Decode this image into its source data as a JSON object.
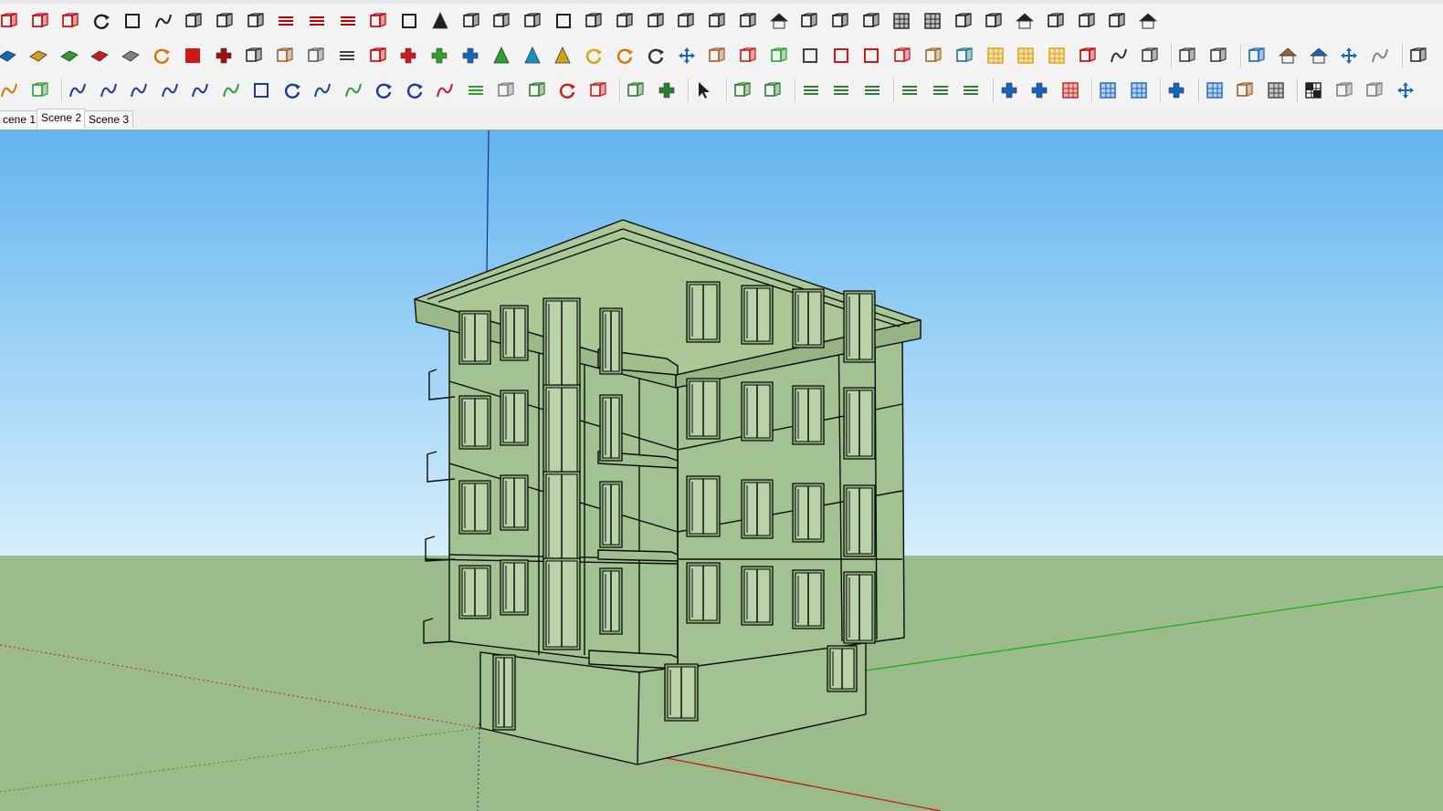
{
  "toolbars": {
    "row1": [
      {
        "name": "dimensions-icon",
        "color": "#c00000"
      },
      {
        "name": "paint-bucket-icon",
        "color": "#c00000"
      },
      {
        "name": "tape-measure-icon",
        "color": "#c00000"
      },
      {
        "name": "sphere-icon",
        "color": "#202020"
      },
      {
        "name": "box-outline-icon",
        "color": "#202020"
      },
      {
        "name": "curve-icon",
        "color": "#202020"
      },
      {
        "name": "cube-icon",
        "color": "#202020"
      },
      {
        "name": "shell-icon",
        "color": "#202020"
      },
      {
        "name": "extrude-icon",
        "color": "#202020"
      },
      {
        "name": "corner-line-icon",
        "color": "#c00000"
      },
      {
        "name": "corner-line-alt-icon",
        "color": "#c00000"
      },
      {
        "name": "arrow-line-icon",
        "color": "#c00000"
      },
      {
        "name": "sweep-icon",
        "color": "#c00000"
      },
      {
        "name": "frame-icon",
        "color": "#202020"
      },
      {
        "name": "cone-icon",
        "color": "#202020"
      },
      {
        "name": "columns-icon",
        "color": "#202020"
      },
      {
        "name": "cylinder-icon",
        "color": "#202020"
      },
      {
        "name": "bin-icon",
        "color": "#202020"
      },
      {
        "name": "panel-icon",
        "color": "#202020"
      },
      {
        "name": "prism-icon",
        "color": "#202020"
      },
      {
        "name": "stairs-icon",
        "color": "#202020"
      },
      {
        "name": "blade-icon",
        "color": "#202020"
      },
      {
        "name": "branch-icon",
        "color": "#202020"
      },
      {
        "name": "branch-alt-icon",
        "color": "#202020"
      },
      {
        "name": "split-icon",
        "color": "#202020"
      },
      {
        "name": "dome-icon",
        "color": "#202020"
      },
      {
        "name": "hatch-icon",
        "color": "#202020"
      },
      {
        "name": "slab-icon",
        "color": "#202020"
      },
      {
        "name": "wall-icon",
        "color": "#202020"
      },
      {
        "name": "grid-wall-icon",
        "color": "#202020"
      },
      {
        "name": "mesh-icon",
        "color": "#202020"
      },
      {
        "name": "louver-icon",
        "color": "#202020"
      },
      {
        "name": "fence-icon",
        "color": "#202020"
      },
      {
        "name": "shell-dome-icon",
        "color": "#202020"
      },
      {
        "name": "ribbed-icon",
        "color": "#202020"
      },
      {
        "name": "fan-icon",
        "color": "#202020"
      },
      {
        "name": "fan-alt-icon",
        "color": "#202020"
      },
      {
        "name": "house-icon",
        "color": "#202020"
      }
    ],
    "row2": [
      {
        "name": "blue-face-icon",
        "color": "#1565c0"
      },
      {
        "name": "yellow-face-icon",
        "color": "#d4a017"
      },
      {
        "name": "green-face-icon",
        "color": "#2e9e2e"
      },
      {
        "name": "red-face-icon",
        "color": "#d01818"
      },
      {
        "name": "outline-face-icon",
        "color": "#808080"
      },
      {
        "name": "rotate-icon",
        "color": "#e07000"
      },
      {
        "name": "red-square-icon",
        "color": "#d01818"
      },
      {
        "name": "lines-box-icon",
        "color": "#a01010"
      },
      {
        "name": "flag-icon",
        "color": "#303030"
      },
      {
        "name": "wood-block-icon",
        "color": "#a0602a"
      },
      {
        "name": "chain-icon",
        "color": "#606060"
      },
      {
        "name": "stairs-outline-icon",
        "color": "#404040"
      },
      {
        "name": "node-path-icon",
        "color": "#c00000"
      },
      {
        "name": "red-cross-icon",
        "color": "#d01818"
      },
      {
        "name": "green-cross-icon",
        "color": "#2e9e2e"
      },
      {
        "name": "blue-x-icon",
        "color": "#1565c0"
      },
      {
        "name": "cone-green-icon",
        "color": "#2e9e2e"
      },
      {
        "name": "cone-blue-icon",
        "color": "#1890c0"
      },
      {
        "name": "triangle-icon",
        "color": "#d4a017"
      },
      {
        "name": "hook-icon",
        "color": "#e0a000"
      },
      {
        "name": "twist-icon",
        "color": "#e07000"
      },
      {
        "name": "refresh-icon",
        "color": "#303030"
      },
      {
        "name": "move-icon",
        "color": "#1565c0"
      },
      {
        "name": "barrel-icon",
        "color": "#a0602a"
      },
      {
        "name": "undo-red-icon",
        "color": "#d01818"
      },
      {
        "name": "leaf-icon",
        "color": "#2e9e2e"
      },
      {
        "name": "box-arrow-icon",
        "color": "#404040"
      },
      {
        "name": "box-red-icon",
        "color": "#d01818"
      },
      {
        "name": "box-pair-icon",
        "color": "#d01818"
      },
      {
        "name": "diamond-icon",
        "color": "#d01818"
      },
      {
        "name": "cubes-icon",
        "color": "#a07020"
      },
      {
        "name": "layers-icon",
        "color": "#207090"
      },
      {
        "name": "grid-orange-icon",
        "color": "#e0a000"
      },
      {
        "name": "grid-yellow-icon",
        "color": "#e0a000"
      },
      {
        "name": "grid-light-icon",
        "color": "#e0a000"
      },
      {
        "name": "scatter-icon",
        "color": "#c00000"
      },
      {
        "name": "dotted-curve-icon",
        "color": "#303030"
      },
      {
        "name": "components-icon",
        "color": "#404040"
      },
      {
        "name": "pencil-icon",
        "color": "#404040"
      },
      {
        "name": "measure-ruler-icon",
        "color": "#404040"
      },
      {
        "name": "follow-me-icon",
        "color": "#1565c0"
      },
      {
        "name": "roof-icon",
        "color": "#a0602a"
      },
      {
        "name": "roof-blue-icon",
        "color": "#1565c0"
      },
      {
        "name": "arrow-blue-icon",
        "color": "#1565c0"
      },
      {
        "name": "curl-icon",
        "color": "#808080"
      },
      {
        "name": "scales-icon",
        "color": "#303030"
      }
    ],
    "row3": [
      {
        "name": "search-orange-icon",
        "color": "#e07000"
      },
      {
        "name": "polyhedron-icon",
        "color": "#2e9e2e"
      },
      {
        "name": "arc-icon",
        "color": "#1a3a9a"
      },
      {
        "name": "zigzag-icon",
        "color": "#1a3a9a"
      },
      {
        "name": "freehand-icon",
        "color": "#1a3a9a"
      },
      {
        "name": "wave-icon",
        "color": "#1a3a9a"
      },
      {
        "name": "curve-s-icon",
        "color": "#1a3a9a"
      },
      {
        "name": "arc-green-icon",
        "color": "#2e9e2e"
      },
      {
        "name": "rectangle-icon",
        "color": "#1a3a9a"
      },
      {
        "name": "spiral-icon",
        "color": "#1a3a9a"
      },
      {
        "name": "arc-blue-icon",
        "color": "#1a3a9a"
      },
      {
        "name": "spline-icon",
        "color": "#2e9e2e"
      },
      {
        "name": "hook-curve-icon",
        "color": "#1a3a9a"
      },
      {
        "name": "half-circle-icon",
        "color": "#1a3a9a"
      },
      {
        "name": "arc-red-icon",
        "color": "#d01818"
      },
      {
        "name": "line-green-icon",
        "color": "#2e9e2e"
      },
      {
        "name": "polygon-icon",
        "color": "#808080"
      },
      {
        "name": "wrench-icon",
        "color": "#2e7d32"
      },
      {
        "name": "circle-red-icon",
        "color": "#d01818"
      },
      {
        "name": "angle-red-icon",
        "color": "#d01818"
      },
      {
        "name": "terrain-icon",
        "color": "#2e7d32"
      },
      {
        "name": "sandbox-icon",
        "color": "#2e7d32"
      },
      {
        "name": "select-cursor-icon",
        "color": "#202020"
      },
      {
        "name": "expand-icon",
        "color": "#2e7d32"
      },
      {
        "name": "shrink-icon",
        "color": "#2e7d32"
      },
      {
        "name": "align-lines-icon",
        "color": "#2e7d32"
      },
      {
        "name": "align-add-icon",
        "color": "#2e7d32"
      },
      {
        "name": "align-remove-icon",
        "color": "#2e7d32"
      },
      {
        "name": "line-split-icon",
        "color": "#2e7d32"
      },
      {
        "name": "line-add-icon",
        "color": "#2e7d32"
      },
      {
        "name": "line-remove-icon",
        "color": "#2e7d32"
      },
      {
        "name": "diagonal-box-icon",
        "color": "#1565c0"
      },
      {
        "name": "grid-box-icon",
        "color": "#1565c0"
      },
      {
        "name": "grid-red-icon",
        "color": "#d01818"
      },
      {
        "name": "table-icon",
        "color": "#1565c0"
      },
      {
        "name": "table-alt-icon",
        "color": "#1565c0"
      },
      {
        "name": "cross-grid-icon",
        "color": "#1565c0"
      },
      {
        "name": "grid-fill-icon",
        "color": "#1565c0"
      },
      {
        "name": "texture-icon",
        "color": "#a0602a"
      },
      {
        "name": "cloud-grid-icon",
        "color": "#404040"
      },
      {
        "name": "checker-icon",
        "color": "#202020"
      },
      {
        "name": "copy-icon",
        "color": "#808080"
      },
      {
        "name": "paste-icon",
        "color": "#808080"
      },
      {
        "name": "move-blue-icon",
        "color": "#1565c0"
      }
    ]
  },
  "scenes": {
    "tabs": [
      "cene 1",
      "Scene 2",
      "Scene 3"
    ],
    "active": "Scene 2"
  },
  "viewport": {
    "sky_top_color": "#62b4ef",
    "sky_bottom_color": "#d6eefc",
    "ground_color": "#9bbc8a",
    "building_color": "#a3c291"
  }
}
